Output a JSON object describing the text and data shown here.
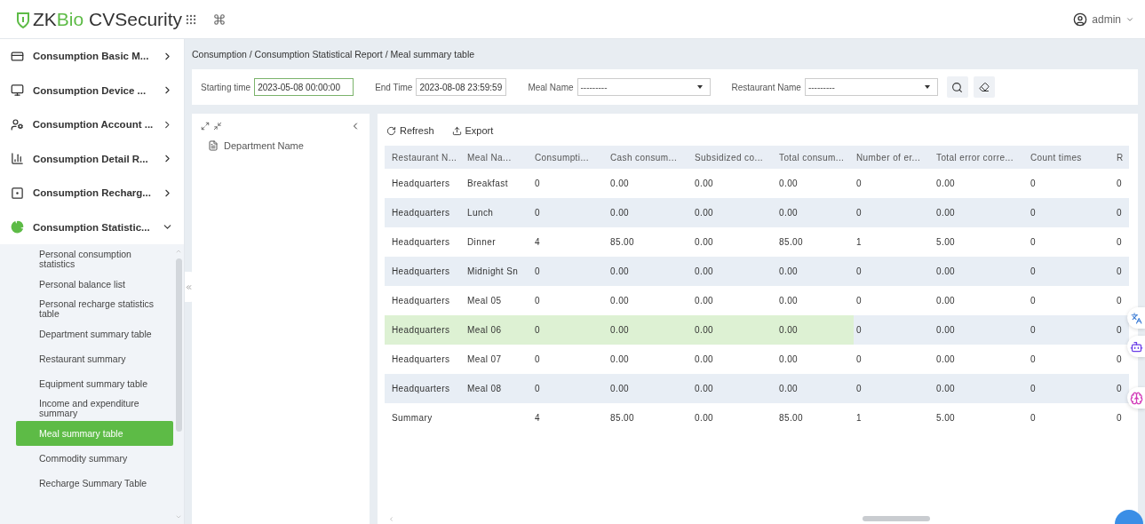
{
  "header": {
    "logo_prefix": "ZK",
    "logo_accent": "Bio",
    "logo_suffix": "CVSecurity",
    "user": "admin"
  },
  "sidebar": {
    "items": [
      {
        "label": "Consumption Basic M...",
        "expanded": false
      },
      {
        "label": "Consumption Device ...",
        "expanded": false
      },
      {
        "label": "Consumption Account ...",
        "expanded": false
      },
      {
        "label": "Consumption Detail R...",
        "expanded": false
      },
      {
        "label": "Consumption Recharg...",
        "expanded": false
      },
      {
        "label": "Consumption Statistic...",
        "expanded": true,
        "children": [
          {
            "label": "Personal consumption statistics",
            "selected": false
          },
          {
            "label": "Personal balance list",
            "selected": false
          },
          {
            "label": "Personal recharge statistics table",
            "selected": false
          },
          {
            "label": "Department summary table",
            "selected": false
          },
          {
            "label": "Restaurant summary",
            "selected": false
          },
          {
            "label": "Equipment summary table",
            "selected": false
          },
          {
            "label": "Income and expenditure summary",
            "selected": false
          },
          {
            "label": "Meal summary table",
            "selected": true
          },
          {
            "label": "Commodity summary",
            "selected": false
          },
          {
            "label": "Recharge Summary Table",
            "selected": false
          }
        ]
      }
    ]
  },
  "breadcrumb": "Consumption / Consumption Statistical Report / Meal summary table",
  "filters": [
    {
      "kind": "text",
      "label": "Starting time",
      "value": "2023-05-08 00:00:00",
      "focused": true
    },
    {
      "kind": "text",
      "label": "End Time",
      "value": "2023-08-08 23:59:59",
      "focused": false
    },
    {
      "kind": "select",
      "label": "Meal Name",
      "value": "---------",
      "focused": false
    },
    {
      "kind": "select",
      "label": "Restaurant Name",
      "value": "---------",
      "focused": false
    }
  ],
  "tree": {
    "items": [
      "Department Name"
    ]
  },
  "toolbar": [
    "Refresh",
    "Export"
  ],
  "table": {
    "columns": [
      "Restaurant N...",
      "Meal Na...",
      "Consumpti...",
      "Cash consum...",
      "Subsidized co...",
      "Total consum...",
      "Number of er...",
      "Total error corre...",
      "Count times",
      "R"
    ],
    "rows": [
      {
        "cells": [
          "Headquarters",
          "Breakfast",
          "0",
          "0.00",
          "0.00",
          "0.00",
          "0",
          "0.00",
          "0",
          "0"
        ],
        "hovered": false
      },
      {
        "cells": [
          "Headquarters",
          "Lunch",
          "0",
          "0.00",
          "0.00",
          "0.00",
          "0",
          "0.00",
          "0",
          "0"
        ],
        "hovered": false
      },
      {
        "cells": [
          "Headquarters",
          "Dinner",
          "4",
          "85.00",
          "0.00",
          "85.00",
          "1",
          "5.00",
          "0",
          "0"
        ],
        "hovered": false
      },
      {
        "cells": [
          "Headquarters",
          "Midnight Sn",
          "0",
          "0.00",
          "0.00",
          "0.00",
          "0",
          "0.00",
          "0",
          "0"
        ],
        "hovered": false
      },
      {
        "cells": [
          "Headquarters",
          "Meal 05",
          "0",
          "0.00",
          "0.00",
          "0.00",
          "0",
          "0.00",
          "0",
          "0"
        ],
        "hovered": false
      },
      {
        "cells": [
          "Headquarters",
          "Meal 06",
          "0",
          "0.00",
          "0.00",
          "0.00",
          "0",
          "0.00",
          "0",
          "0"
        ],
        "hovered": true
      },
      {
        "cells": [
          "Headquarters",
          "Meal 07",
          "0",
          "0.00",
          "0.00",
          "0.00",
          "0",
          "0.00",
          "0",
          "0"
        ],
        "hovered": false
      },
      {
        "cells": [
          "Headquarters",
          "Meal 08",
          "0",
          "0.00",
          "0.00",
          "0.00",
          "0",
          "0.00",
          "0",
          "0"
        ],
        "hovered": false
      },
      {
        "cells": [
          "Summary",
          "",
          "4",
          "85.00",
          "0.00",
          "85.00",
          "1",
          "5.00",
          "0",
          "0"
        ],
        "hovered": false
      }
    ]
  }
}
